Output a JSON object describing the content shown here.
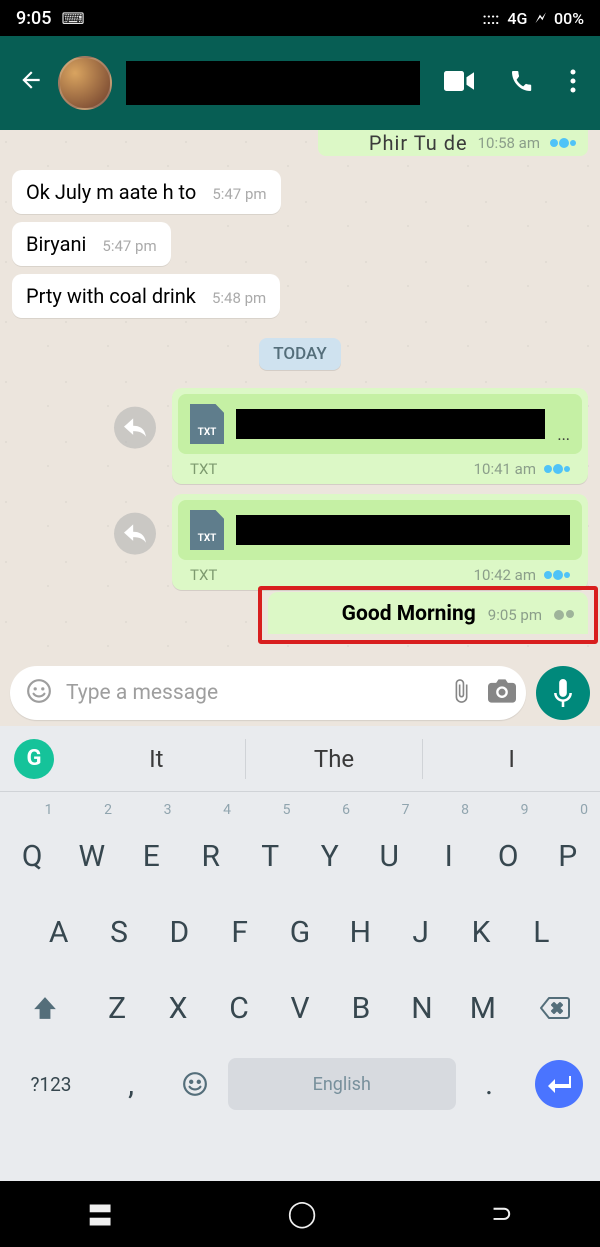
{
  "status": {
    "time": "9:05",
    "network": "4G",
    "battery": "00%"
  },
  "header": {
    "video": "video",
    "call": "call",
    "menu": "menu"
  },
  "chat": {
    "partial": {
      "text": "Phir Tu de",
      "time": "10:58 am"
    },
    "in": [
      {
        "text": "Ok July m aate h to",
        "time": "5:47 pm"
      },
      {
        "text": "Biryani",
        "time": "5:47 pm"
      },
      {
        "text": "Prty with coal drink",
        "time": "5:48 pm"
      }
    ],
    "date": "TODAY",
    "files": [
      {
        "ext": "TXT",
        "meta": "TXT",
        "time": "10:41 am"
      },
      {
        "ext": "TXT",
        "meta": "TXT",
        "time": "10:42 am"
      }
    ],
    "out_text": {
      "text": "Good Morning",
      "time": "9:05 pm"
    }
  },
  "input": {
    "placeholder": "Type a message"
  },
  "keyboard": {
    "suggestions": [
      "It",
      "The",
      "I"
    ],
    "row1": [
      "Q",
      "W",
      "E",
      "R",
      "T",
      "Y",
      "U",
      "I",
      "O",
      "P"
    ],
    "hints": [
      "1",
      "2",
      "3",
      "4",
      "5",
      "6",
      "7",
      "8",
      "9",
      "0"
    ],
    "row2": [
      "A",
      "S",
      "D",
      "F",
      "G",
      "H",
      "J",
      "K",
      "L"
    ],
    "row3": [
      "Z",
      "X",
      "C",
      "V",
      "B",
      "N",
      "M"
    ],
    "sym": "?123",
    "comma": ",",
    "space": "English",
    "period": "."
  }
}
